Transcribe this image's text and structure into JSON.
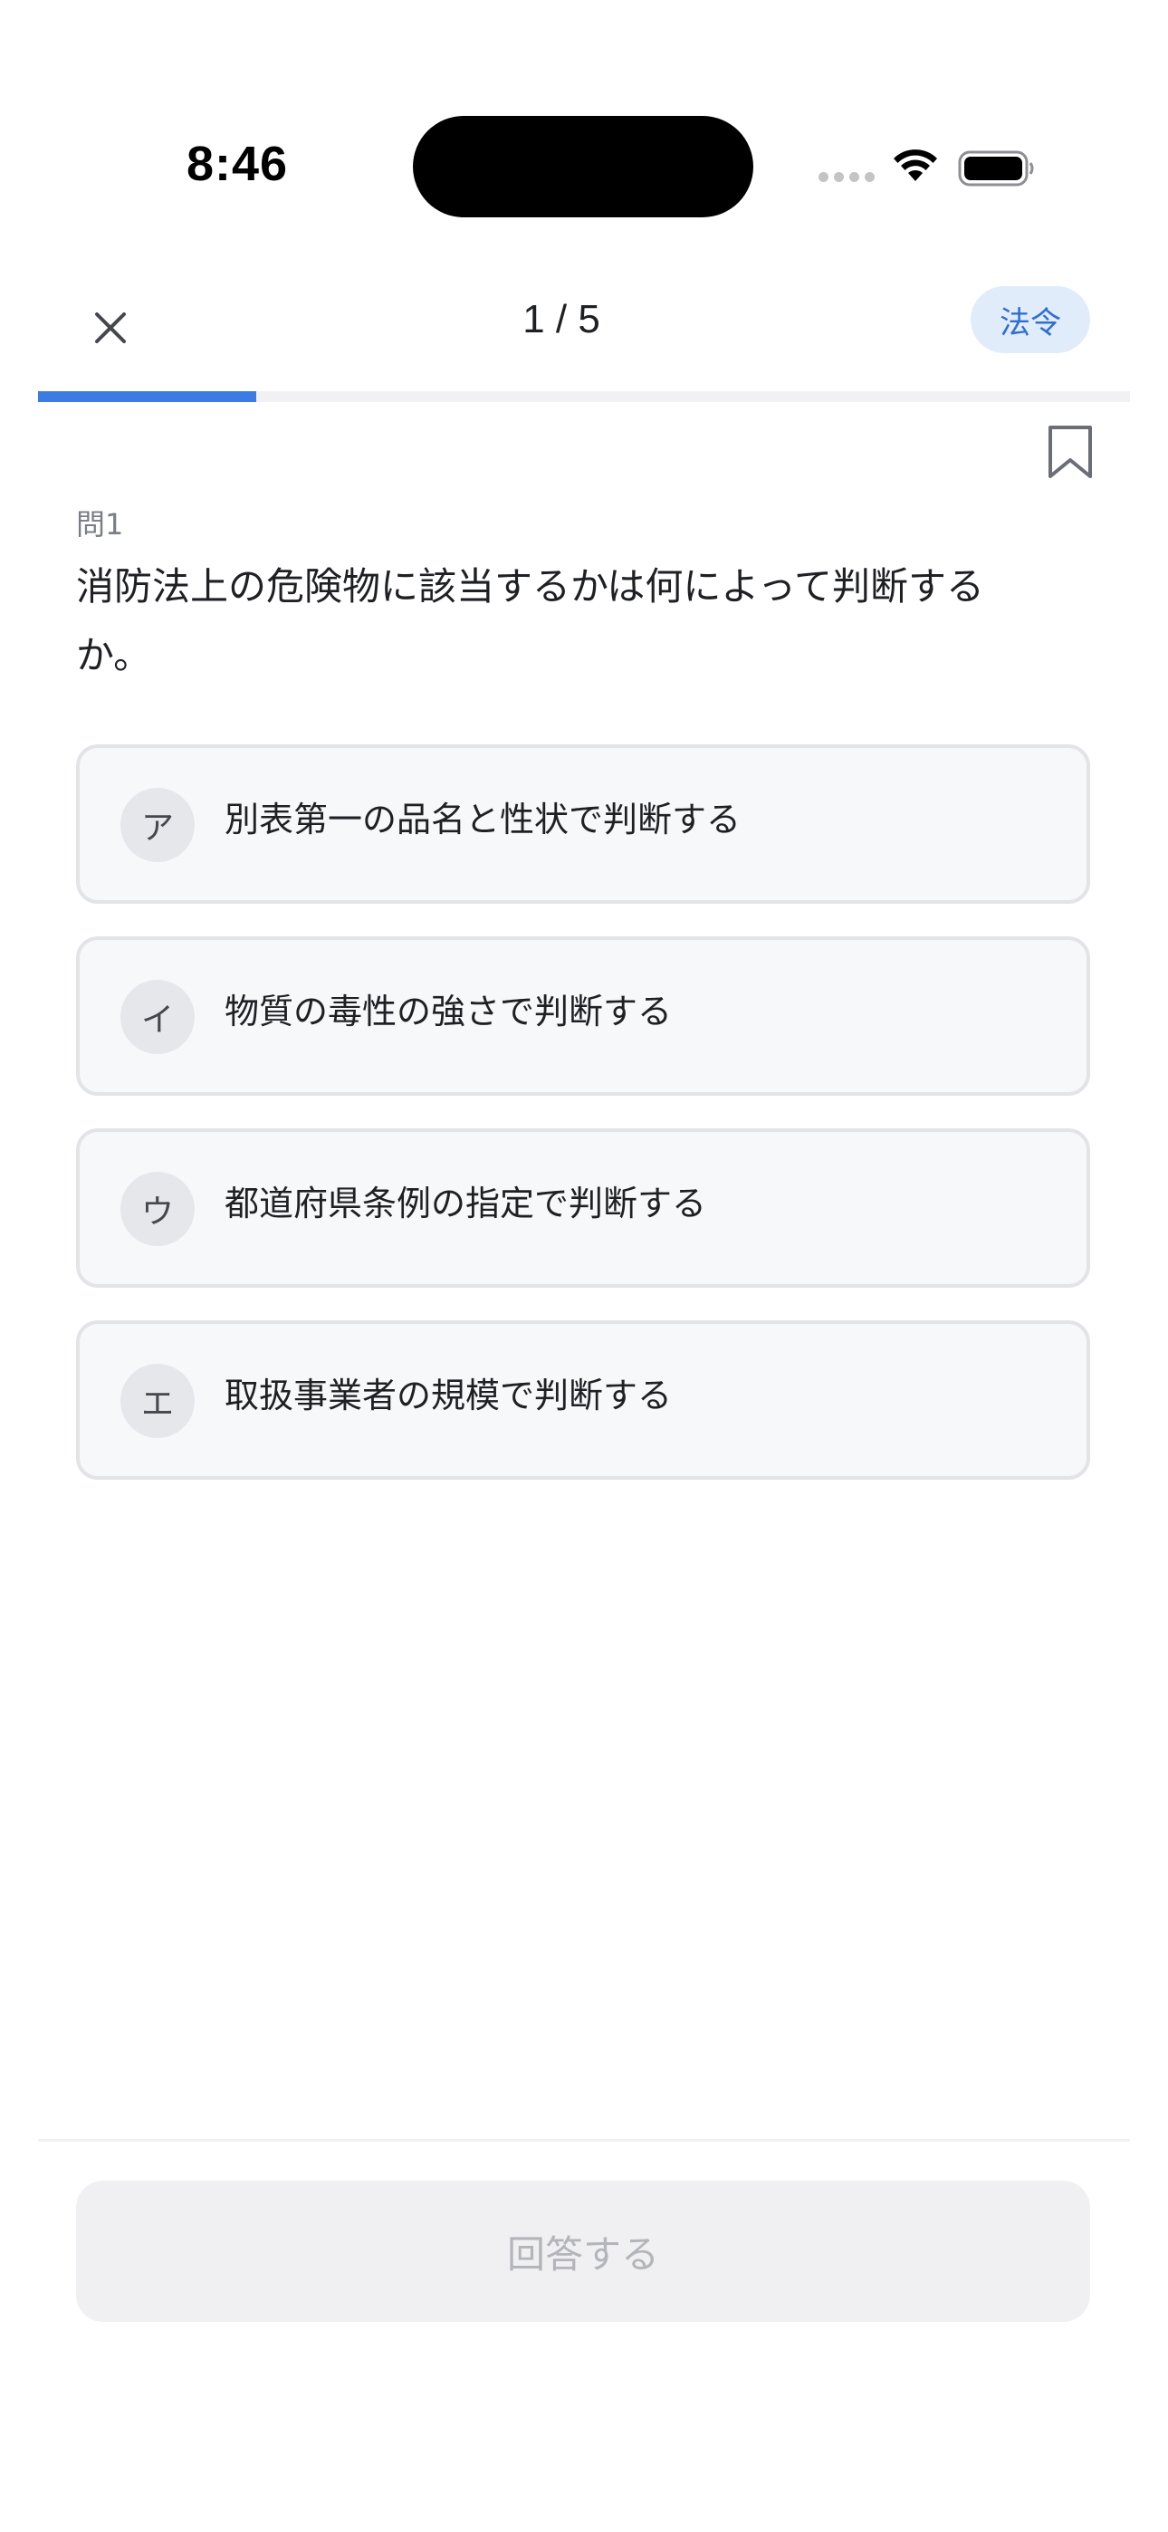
{
  "status_bar": {
    "time": "8:46"
  },
  "header": {
    "close_icon": "close-icon",
    "counter": "1 / 5",
    "category": "法令"
  },
  "progress": {
    "current": 1,
    "total": 5,
    "fraction": 0.2
  },
  "question": {
    "number_label": "問1",
    "text": "消防法上の危険物に該当するかは何によって判断するか。"
  },
  "options": [
    {
      "letter": "ア",
      "text": "別表第一の品名と性状で判断する"
    },
    {
      "letter": "イ",
      "text": "物質の毒性の強さで判断する"
    },
    {
      "letter": "ウ",
      "text": "都道府県条例の指定で判断する"
    },
    {
      "letter": "エ",
      "text": "取扱事業者の規模で判断する"
    }
  ],
  "submit": {
    "label": "回答する"
  },
  "colors": {
    "accent": "#3d7be4",
    "badge_bg": "#e1ecfb",
    "badge_text": "#2e6fd0"
  }
}
